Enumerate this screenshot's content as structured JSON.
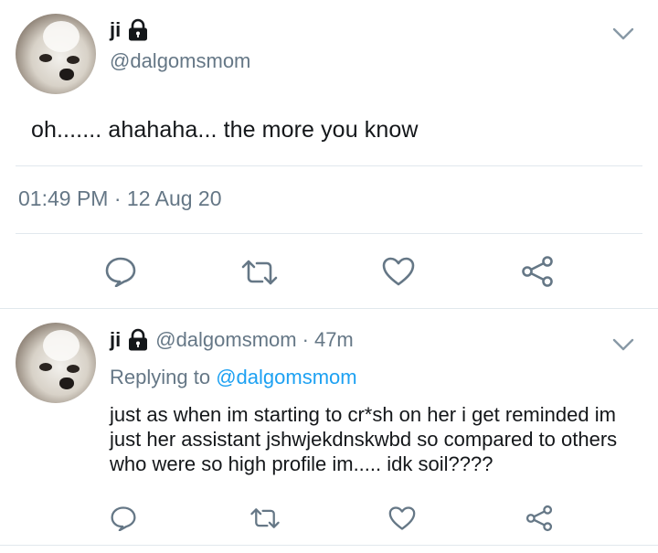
{
  "main_tweet": {
    "display_name": "ji",
    "handle": "@dalgomsmom",
    "text": "oh....... ahahaha... the more you know",
    "time": "01:49 PM",
    "separator": "·",
    "date": "12 Aug 20",
    "icons": [
      "lock-icon",
      "chevron-down-icon",
      "reply-icon",
      "retweet-icon",
      "like-icon",
      "share-icon"
    ]
  },
  "reply_tweet": {
    "display_name": "ji",
    "handle": "@dalgomsmom",
    "separator": "·",
    "age": "47m",
    "replying_prefix": "Replying to",
    "replying_to": "@dalgomsmom",
    "text": "just as when im starting to cr*sh on her i get reminded im just her assistant jshwjekdnskwbd so compared to others who were so high profile im..... idk soil????",
    "icons": [
      "lock-icon",
      "chevron-down-icon",
      "reply-icon",
      "retweet-icon",
      "like-icon",
      "share-icon"
    ]
  },
  "colors": {
    "text": "#14171a",
    "muted": "#657786",
    "link": "#1da1f2",
    "divider": "#e1e8ed",
    "icon": "#657786"
  }
}
